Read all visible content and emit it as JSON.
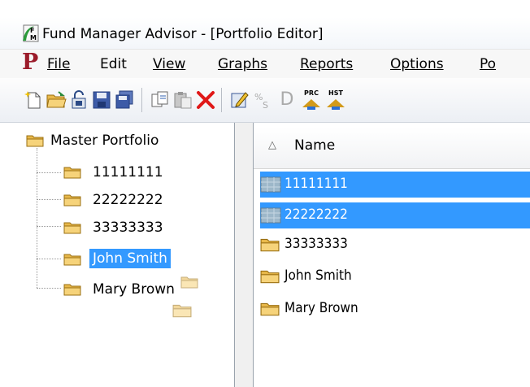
{
  "window": {
    "title": "Fund Manager Advisor - [Portfolio Editor]"
  },
  "menu": {
    "logo": "P",
    "items": [
      "File",
      "Edit",
      "View",
      "Graphs",
      "Reports",
      "Options",
      "Po"
    ]
  },
  "toolbar": {
    "prc_label": "PRC",
    "hst_label": "HST",
    "d_label": "D"
  },
  "tree": {
    "root": "Master Portfolio",
    "children": [
      "11111111",
      "22222222",
      "33333333",
      "John Smith",
      "Mary Brown"
    ],
    "selected": "John Smith"
  },
  "list": {
    "header": "Name",
    "rows": [
      {
        "name": "11111111",
        "selected": true
      },
      {
        "name": "22222222",
        "selected": true
      },
      {
        "name": "33333333",
        "selected": false
      },
      {
        "name": "John Smith",
        "selected": false
      },
      {
        "name": "Mary Brown",
        "selected": false
      }
    ]
  },
  "colors": {
    "selection": "#3399ff",
    "menu_logo": "#9b1b2a"
  }
}
